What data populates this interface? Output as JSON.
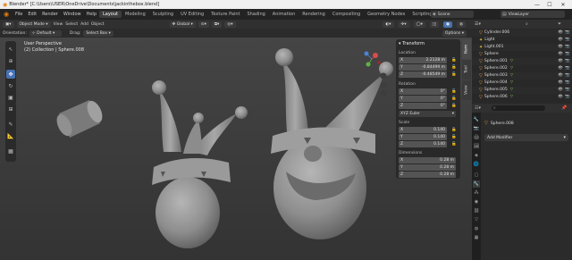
{
  "window": {
    "title": "Blender* [C:\\Users\\USER\\OneDrive\\Documents\\jackinthebox.blend]",
    "minimize": "—",
    "maximize": "☐",
    "close": "✕"
  },
  "menu": [
    "File",
    "Edit",
    "Render",
    "Window",
    "Help"
  ],
  "workspaces": [
    "Layout",
    "Modeling",
    "Sculpting",
    "UV Editing",
    "Texture Paint",
    "Shading",
    "Animation",
    "Rendering",
    "Compositing",
    "Geometry Nodes",
    "Scripting"
  ],
  "scene": {
    "label": "Scene",
    "view_layer": "ViewLayer"
  },
  "viewport_header": {
    "mode": "Object Mode",
    "view": "View",
    "select": "Select",
    "add": "Add",
    "object": "Object",
    "orientation_global": "Global"
  },
  "viewport_sub": {
    "orientation_label": "Orientation:",
    "orientation_value": "Default",
    "drag_label": "Drag:",
    "drag_value": "Select Box",
    "options": "Options"
  },
  "overlay": {
    "view_name": "User Perspective",
    "collection": "(2) Collection | Sphere.008"
  },
  "side_tabs": [
    "Item",
    "Tool",
    "View"
  ],
  "transform": {
    "title": "Transform",
    "location_label": "Location",
    "location": [
      {
        "axis": "X",
        "value": "2.2128 m"
      },
      {
        "axis": "Y",
        "value": "-0.84499 m"
      },
      {
        "axis": "Z",
        "value": "-0.48549 m"
      }
    ],
    "rotation_label": "Rotation",
    "rotation": [
      {
        "axis": "X",
        "value": "0°"
      },
      {
        "axis": "Y",
        "value": "0°"
      },
      {
        "axis": "Z",
        "value": "0°"
      }
    ],
    "rotation_mode": "XYZ Euler",
    "scale_label": "Scale",
    "scale": [
      {
        "axis": "X",
        "value": "0.140"
      },
      {
        "axis": "Y",
        "value": "0.140"
      },
      {
        "axis": "Z",
        "value": "0.140"
      }
    ],
    "dimensions_label": "Dimensions",
    "dimensions": [
      {
        "axis": "X",
        "value": "0.28 m"
      },
      {
        "axis": "Y",
        "value": "0.28 m"
      },
      {
        "axis": "Z",
        "value": "0.28 m"
      }
    ]
  },
  "outliner": {
    "items": [
      "Cylinder.006",
      "Light",
      "Light.001",
      "Sphere",
      "Sphere.001",
      "Sphere.002",
      "Sphere.003",
      "Sphere.004",
      "Sphere.005",
      "Sphere.006"
    ]
  },
  "properties": {
    "object_name": "Sphere.008",
    "add_modifier": "Add Modifier"
  },
  "colors": {
    "accent": "#4772b3",
    "orange": "#e9a13b",
    "object_green": "#7fbf5f"
  }
}
